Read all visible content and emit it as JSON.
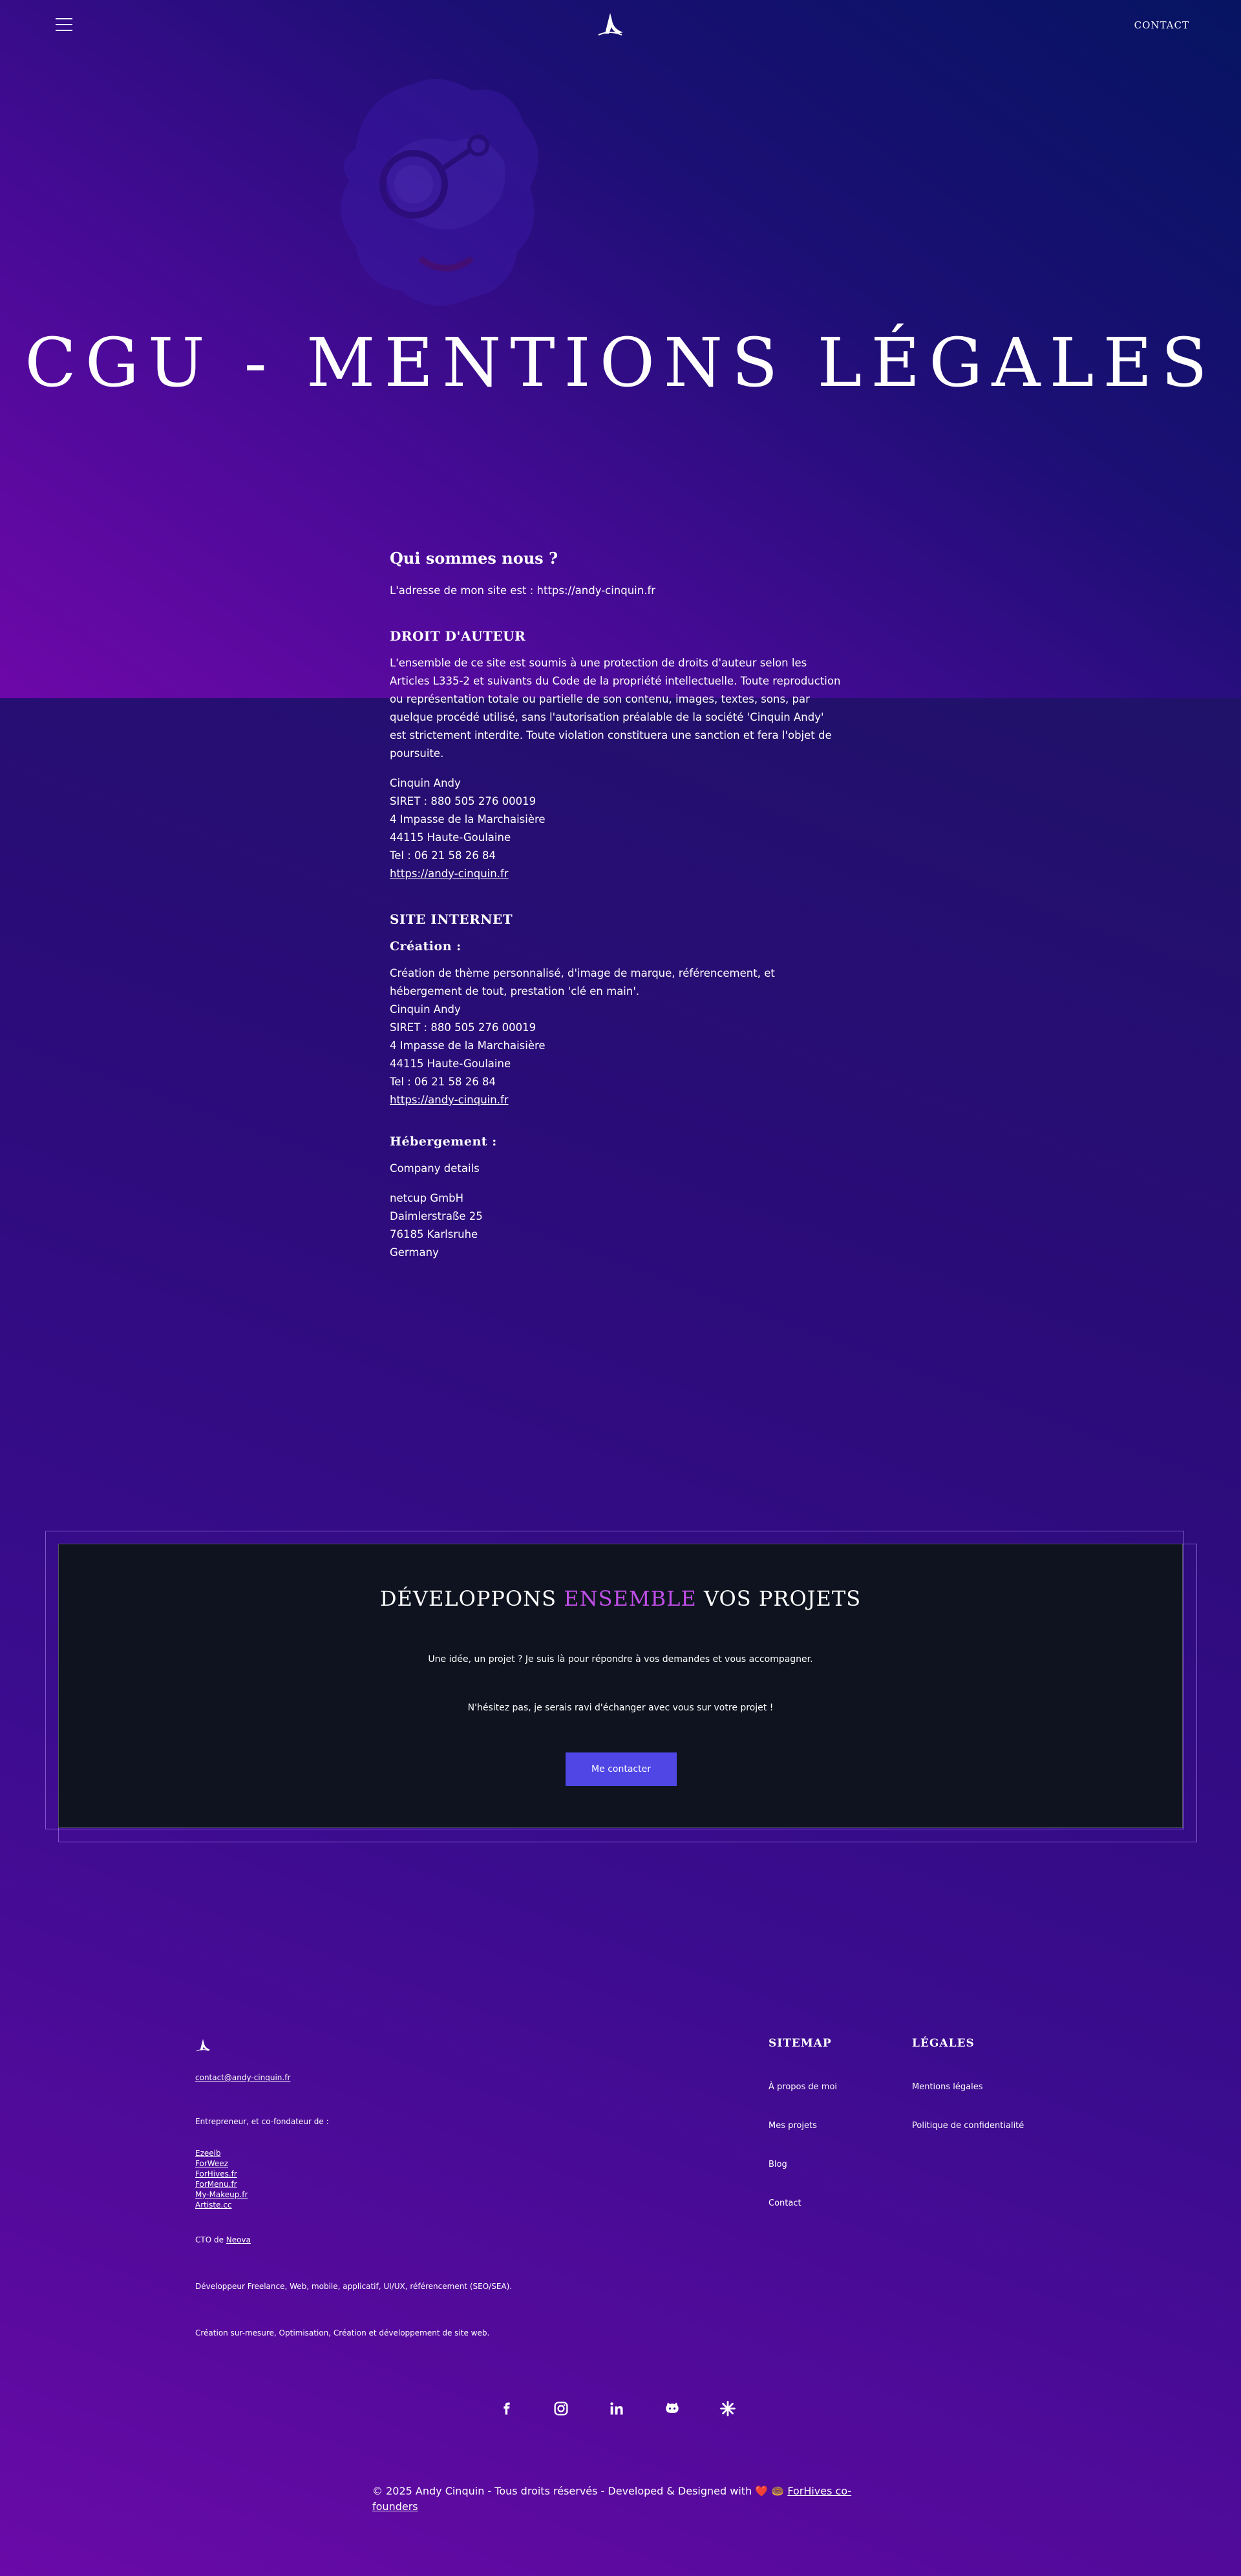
{
  "header": {
    "contact_label": "CONTACT"
  },
  "hero": {
    "title": "CGU - MENTIONS LÉGALES"
  },
  "content": {
    "about": {
      "heading": "Qui sommes nous ?",
      "text": "L'adresse de mon site est : https://andy-cinquin.fr"
    },
    "copyright": {
      "heading": "DROIT D'AUTEUR",
      "text": "L'ensemble de ce site est soumis à une protection de droits d'auteur selon les Articles L335-2 et suivants du Code de la propriété intellectuelle. Toute reproduction ou représentation totale ou partielle de son contenu, images, textes, sons, par quelque procédé utilisé, sans l'autorisation préalable de la société 'Cinquin Andy' est strictement interdite. Toute violation constituera une sanction et fera l'objet de poursuite.",
      "name": "Cinquin Andy",
      "siret": "SIRET : 880 505 276 00019",
      "street": "4 Impasse de la Marchaisière",
      "city": "44115 Haute-Goulaine",
      "tel": "Tel : 06 21 58 26 84",
      "link": "https://andy-cinquin.fr"
    },
    "website": {
      "heading": "SITE INTERNET",
      "creation_heading": "Création :",
      "creation_text": "Création de thème personnalisé, d'image de marque, référencement, et hébergement de tout, prestation 'clé en main'.",
      "name": "Cinquin Andy",
      "siret": "SIRET : 880 505 276 00019",
      "street": "4 Impasse de la Marchaisière",
      "city": "44115 Haute-Goulaine",
      "tel": "Tel : 06 21 58 26 84",
      "link": "https://andy-cinquin.fr",
      "hosting_heading": "Hébergement :",
      "hosting_label": "Company details",
      "host_name": "netcup GmbH",
      "host_street": "Daimlerstraße 25",
      "host_city": "76185 Karlsruhe",
      "host_country": "Germany"
    }
  },
  "cta": {
    "title_part1": "DÉVELOPPONS ",
    "title_accent": "ENSEMBLE",
    "title_part2": " VOS PROJETS",
    "text1": "Une idée, un projet ? Je suis là pour répondre à vos demandes et vous accompagner.",
    "text2": "N'hésitez pas, je serais ravi d'échanger avec vous sur votre projet !",
    "button_label": "Me contacter"
  },
  "footer": {
    "email": "contact@andy-cinquin.fr",
    "cofounder_intro": "Entrepreneur, et co-fondateur de :",
    "companies": [
      "Ezeeib",
      "ForWeez",
      "ForHives.fr",
      "ForMenu.fr",
      "My-Makeup.fr",
      "Artiste.cc"
    ],
    "cto_prefix": "CTO de ",
    "cto_company": "Neova",
    "dev_text": "Développeur Freelance, Web, mobile, applicatif, UI/UX, référencement (SEO/SEA).",
    "creation_text": "Création sur-mesure, Optimisation, Création et développement de site web.",
    "sitemap_heading": "SITEMAP",
    "sitemap": [
      "À propos de moi",
      "Mes projets",
      "Blog",
      "Contact"
    ],
    "legal_heading": "LÉGALES",
    "legal": [
      "Mentions légales",
      "Politique de confidentialité"
    ],
    "socials": [
      "facebook-icon",
      "instagram-icon",
      "linkedin-icon",
      "github-icon",
      "malt-icon"
    ],
    "copyright_text": "© 2025 Andy Cinquin - Tous droits réservés - Developed & Designed with ❤️ 🍩 ",
    "copyright_link": "ForHives co-founders"
  },
  "colors": {
    "accent": "#c04ee8",
    "button": "#4f46e5",
    "cta_bg": "#0f131f"
  }
}
